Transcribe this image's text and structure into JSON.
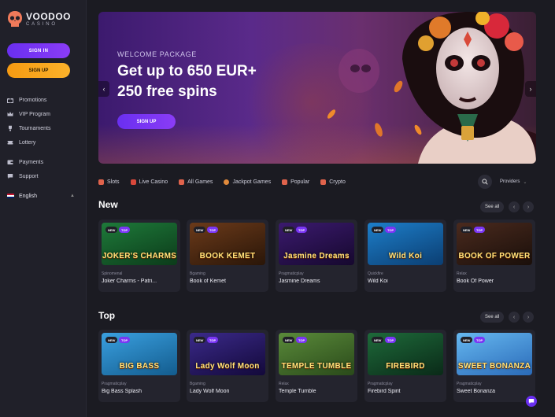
{
  "brand": {
    "name": "VOODOO",
    "sub": "CASINO"
  },
  "auth": {
    "signin": "SIGN IN",
    "signup": "SIGN UP"
  },
  "nav": [
    {
      "label": "Promotions",
      "icon": "gift-icon"
    },
    {
      "label": "VIP Program",
      "icon": "crown-icon"
    },
    {
      "label": "Tournaments",
      "icon": "trophy-icon"
    },
    {
      "label": "Lottery",
      "icon": "ticket-icon"
    },
    {
      "label": "Payments",
      "icon": "wallet-icon"
    },
    {
      "label": "Support",
      "icon": "chat-icon"
    }
  ],
  "language": "English",
  "hero": {
    "subtitle": "WELCOME PACKAGE",
    "title_line1": "Get up to 650 EUR+",
    "title_line2": "250 free spins",
    "cta": "SIGN UP"
  },
  "categories": [
    {
      "label": "Slots",
      "color": "#e0634c"
    },
    {
      "label": "Live Casino",
      "color": "#d9483b"
    },
    {
      "label": "All Games",
      "color": "#e0634c"
    },
    {
      "label": "Jackpot Games",
      "color": "#e08a3c"
    },
    {
      "label": "Popular",
      "color": "#e0634c"
    },
    {
      "label": "Crypto",
      "color": "#e0634c"
    }
  ],
  "providers_label": "Providers",
  "sections": {
    "new": {
      "title": "New",
      "see_all": "See all",
      "games": [
        {
          "provider": "Spinomenal",
          "name": "Joker Charms - Patri...",
          "art": "JOKER'S CHARMS",
          "bg1": "#1e7a3a",
          "bg2": "#0c3b1a",
          "badges": [
            "NEW",
            "TOP"
          ]
        },
        {
          "provider": "Bgaming",
          "name": "Book of Kemet",
          "art": "BOOK KEMET",
          "bg1": "#6b3a1a",
          "bg2": "#2a1608",
          "badges": [
            "NEW",
            "TOP"
          ]
        },
        {
          "provider": "Pragmaticplay",
          "name": "Jasmine Dreams",
          "art": "Jasmine Dreams",
          "bg1": "#3b1a6e",
          "bg2": "#16082e",
          "badges": [
            "NEW",
            "TOP"
          ]
        },
        {
          "provider": "Quickfire",
          "name": "Wild Koi",
          "art": "Wild Koi",
          "bg1": "#1d7ec9",
          "bg2": "#0b3e72",
          "badges": [
            "NEW",
            "TOP"
          ]
        },
        {
          "provider": "Relax",
          "name": "Book Of Power",
          "art": "BOOK OF POWER",
          "bg1": "#4a2a1e",
          "bg2": "#1a0f0a",
          "badges": [
            "NEW",
            "TOP"
          ]
        }
      ]
    },
    "top": {
      "title": "Top",
      "see_all": "See all",
      "games": [
        {
          "provider": "Pragmaticplay",
          "name": "Big Bass Splash",
          "art": "BIG BASS",
          "bg1": "#3aa0e0",
          "bg2": "#135c8e",
          "badges": [
            "NEW",
            "TOP"
          ]
        },
        {
          "provider": "Bgaming",
          "name": "Lady Wolf Moon",
          "art": "Lady Wolf Moon",
          "bg1": "#3b2a8a",
          "bg2": "#13093a",
          "badges": [
            "NEW",
            "TOP"
          ]
        },
        {
          "provider": "Relax",
          "name": "Temple Tumble",
          "art": "TEMPLE TUMBLE",
          "bg1": "#5a8a3a",
          "bg2": "#2a4a1a",
          "badges": [
            "NEW",
            "TOP"
          ]
        },
        {
          "provider": "Pragmaticplay",
          "name": "Firebird Spirit",
          "art": "FIREBIRD",
          "bg1": "#1e6a3a",
          "bg2": "#0a2a18",
          "badges": [
            "NEW",
            "TOP"
          ]
        },
        {
          "provider": "Pragmaticplay",
          "name": "Sweet Bonanza",
          "art": "SWEET BONANZA",
          "bg1": "#66b8f0",
          "bg2": "#2a6ab8",
          "badges": [
            "NEW",
            "TOP"
          ]
        }
      ]
    }
  }
}
